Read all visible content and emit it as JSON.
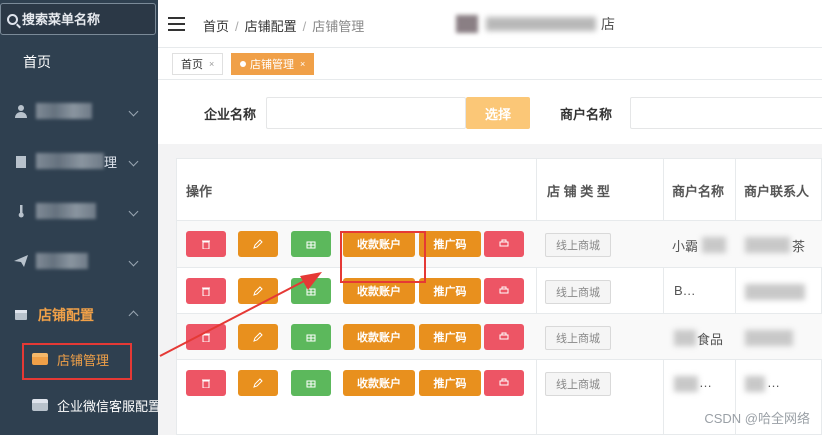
{
  "sidebar": {
    "search_placeholder": "搜索菜单名称",
    "home": "首页",
    "group_active": "店铺配置",
    "sub_items": [
      "店铺管理",
      "企业微信客服配置"
    ],
    "partial_text": "理"
  },
  "header": {
    "breadcrumb": [
      "首页",
      "店铺配置",
      "店铺管理"
    ],
    "shop_suffix": "店"
  },
  "tabs": [
    {
      "label": "首页",
      "active": false
    },
    {
      "label": "店铺管理",
      "active": true
    }
  ],
  "filter": {
    "company_label": "企业名称",
    "select_button": "选择",
    "merchant_label": "商户名称"
  },
  "table": {
    "headers": [
      "操作",
      "店 铺 类 型",
      "商户名称",
      "商户联系人"
    ],
    "action_labels": {
      "collect": "收款账户",
      "promo": "推广码"
    },
    "rows": [
      {
        "type": "线上商城",
        "name": "小霸",
        "contact": "茶"
      },
      {
        "type": "线上商城",
        "name": "B…",
        "contact": ""
      },
      {
        "type": "线上商城",
        "name": "食品",
        "contact": ""
      },
      {
        "type": "线上商城",
        "name": "…",
        "contact": "…"
      }
    ]
  },
  "watermark": "CSDN @哈全网络",
  "colors": {
    "accent": "#f0a048",
    "sidebar": "#2f4050",
    "danger": "#ed5565",
    "success": "#5cb85c",
    "warning": "#e8901e",
    "annotation": "#e53935"
  }
}
